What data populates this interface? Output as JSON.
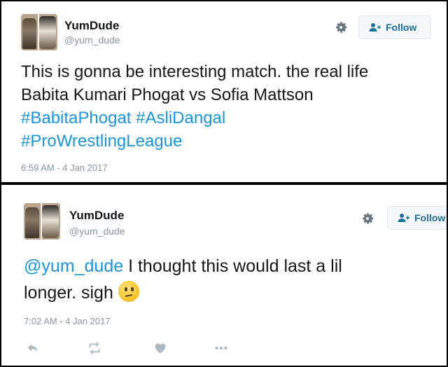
{
  "tweets": [
    {
      "user": {
        "name": "YumDude",
        "handle": "@yum_dude"
      },
      "follow_label": "Follow",
      "lines": [
        "This is gonna be interesting match. the real life",
        "Babita Kumari Phogat vs Sofia Mattson"
      ],
      "hashtags": [
        "#BabitaPhogat",
        "#AsliDangal",
        "#ProWrestlingLeague"
      ],
      "timestamp": "6:59 AM - 4 Jan 2017"
    },
    {
      "user": {
        "name": "YumDude",
        "handle": "@yum_dude"
      },
      "follow_label": "Follow",
      "mention": "@yum_dude",
      "line1": " I thought this would last a lil",
      "line2": "longer. sigh",
      "emoji": "confused-face-emoji",
      "timestamp": "7:02 AM - 4 Jan 2017"
    }
  ],
  "colors": {
    "link": "#1b95e0",
    "muted": "#8899a6",
    "follow_text": "#1d6f9f"
  }
}
